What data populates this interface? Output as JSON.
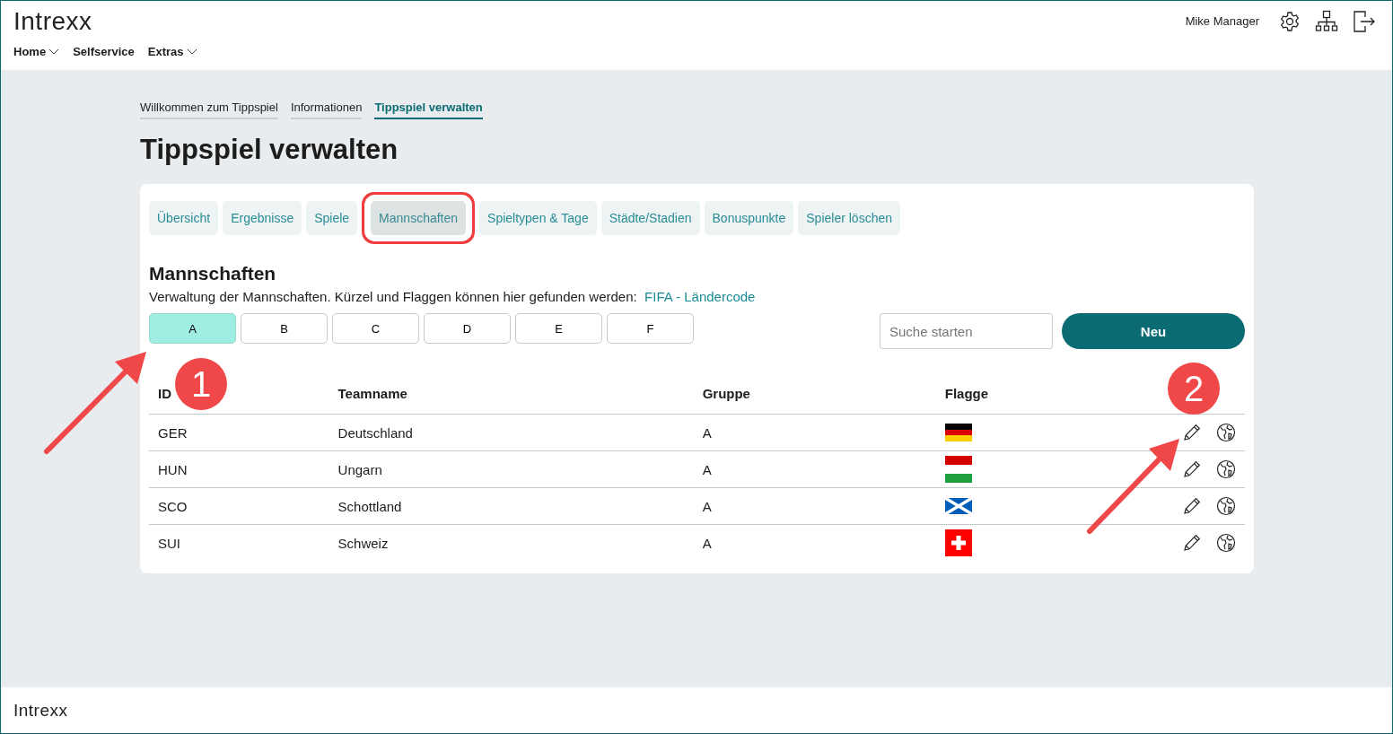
{
  "header": {
    "logo": "Intrexx",
    "nav": [
      {
        "label": "Home",
        "dropdown": true
      },
      {
        "label": "Selfservice",
        "dropdown": false
      },
      {
        "label": "Extras",
        "dropdown": true
      }
    ],
    "user": "Mike Manager"
  },
  "breadcrumbs": [
    {
      "label": "Willkommen zum Tippspiel",
      "selected": false
    },
    {
      "label": "Informationen",
      "selected": false
    },
    {
      "label": "Tippspiel verwalten",
      "selected": true
    }
  ],
  "page_title": "Tippspiel verwalten",
  "tabs": [
    {
      "label": "Übersicht",
      "selected": false
    },
    {
      "label": "Ergebnisse",
      "selected": false
    },
    {
      "label": "Spiele",
      "selected": false
    },
    {
      "label": "Mannschaften",
      "selected": true
    },
    {
      "label": "Spieltypen & Tage",
      "selected": false
    },
    {
      "label": "Städte/Stadien",
      "selected": false
    },
    {
      "label": "Bonuspunkte",
      "selected": false
    },
    {
      "label": "Spieler löschen",
      "selected": false
    }
  ],
  "section": {
    "title": "Mannschaften",
    "description": "Verwaltung der Mannschaften. Kürzel und Flaggen können hier gefunden werden:",
    "link": "FIFA - Ländercode"
  },
  "groups": [
    {
      "label": "A",
      "selected": true
    },
    {
      "label": "B",
      "selected": false
    },
    {
      "label": "C",
      "selected": false
    },
    {
      "label": "D",
      "selected": false
    },
    {
      "label": "E",
      "selected": false
    },
    {
      "label": "F",
      "selected": false
    }
  ],
  "search": {
    "placeholder": "Suche starten"
  },
  "new_button": "Neu",
  "table": {
    "columns": [
      "ID",
      "Teamname",
      "Gruppe",
      "Flagge"
    ],
    "rows": [
      {
        "id": "GER",
        "name": "Deutschland",
        "group": "A",
        "kind": "germany"
      },
      {
        "id": "HUN",
        "name": "Ungarn",
        "group": "A",
        "kind": "hungary"
      },
      {
        "id": "SCO",
        "name": "Schottland",
        "group": "A",
        "kind": "scotland"
      },
      {
        "id": "SUI",
        "name": "Schweiz",
        "group": "A",
        "kind": "switzerland"
      }
    ]
  },
  "footer": {
    "logo": "Intrexx"
  },
  "annotations": [
    {
      "number": "1"
    },
    {
      "number": "2"
    }
  ]
}
